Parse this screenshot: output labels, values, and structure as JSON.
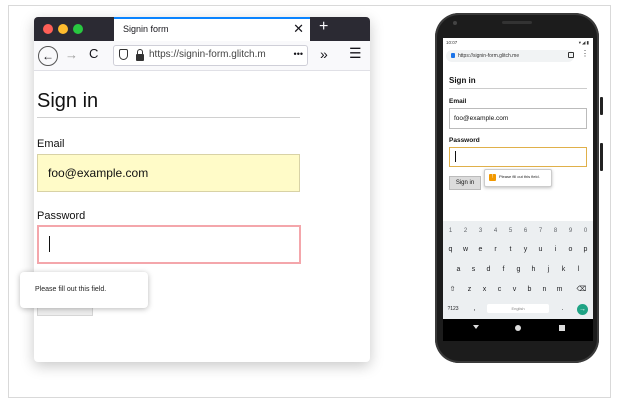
{
  "desktop": {
    "tab_title": "Signin form",
    "tab_close": "✕",
    "new_tab": "+",
    "back": "←",
    "forward": "→",
    "reload": "C",
    "url": "https://signin-form.glitch.m",
    "url_more": "•••",
    "overflow": "»",
    "menu": "☰",
    "form": {
      "title": "Sign in",
      "email_label": "Email",
      "email_value": "foo@example.com",
      "password_label": "Password",
      "password_value": ""
    },
    "tooltip": "Please fill out this field."
  },
  "mobile": {
    "status_time": "10:07",
    "status_icons": "▾◢▮",
    "url": "https://signin-form.glitch.me",
    "menu": "⋮",
    "form": {
      "title": "Sign in",
      "email_label": "Email",
      "email_value": "foo@example.com",
      "password_label": "Password",
      "password_value": "",
      "button": "Sign in"
    },
    "tooltip": "Please fill out this field.",
    "tooltip_icon": "!",
    "keyboard": {
      "numbers": [
        "1",
        "2",
        "3",
        "4",
        "5",
        "6",
        "7",
        "8",
        "9",
        "0"
      ],
      "row1": [
        "q",
        "w",
        "e",
        "r",
        "t",
        "y",
        "u",
        "i",
        "o",
        "p"
      ],
      "row2": [
        "a",
        "s",
        "d",
        "f",
        "g",
        "h",
        "j",
        "k",
        "l"
      ],
      "row3": [
        "⇧",
        "z",
        "x",
        "c",
        "v",
        "b",
        "n",
        "m",
        "⌫"
      ],
      "mode_key": "?123",
      "comma": ",",
      "space_label": "English",
      "period": ".",
      "enter": "→"
    }
  }
}
